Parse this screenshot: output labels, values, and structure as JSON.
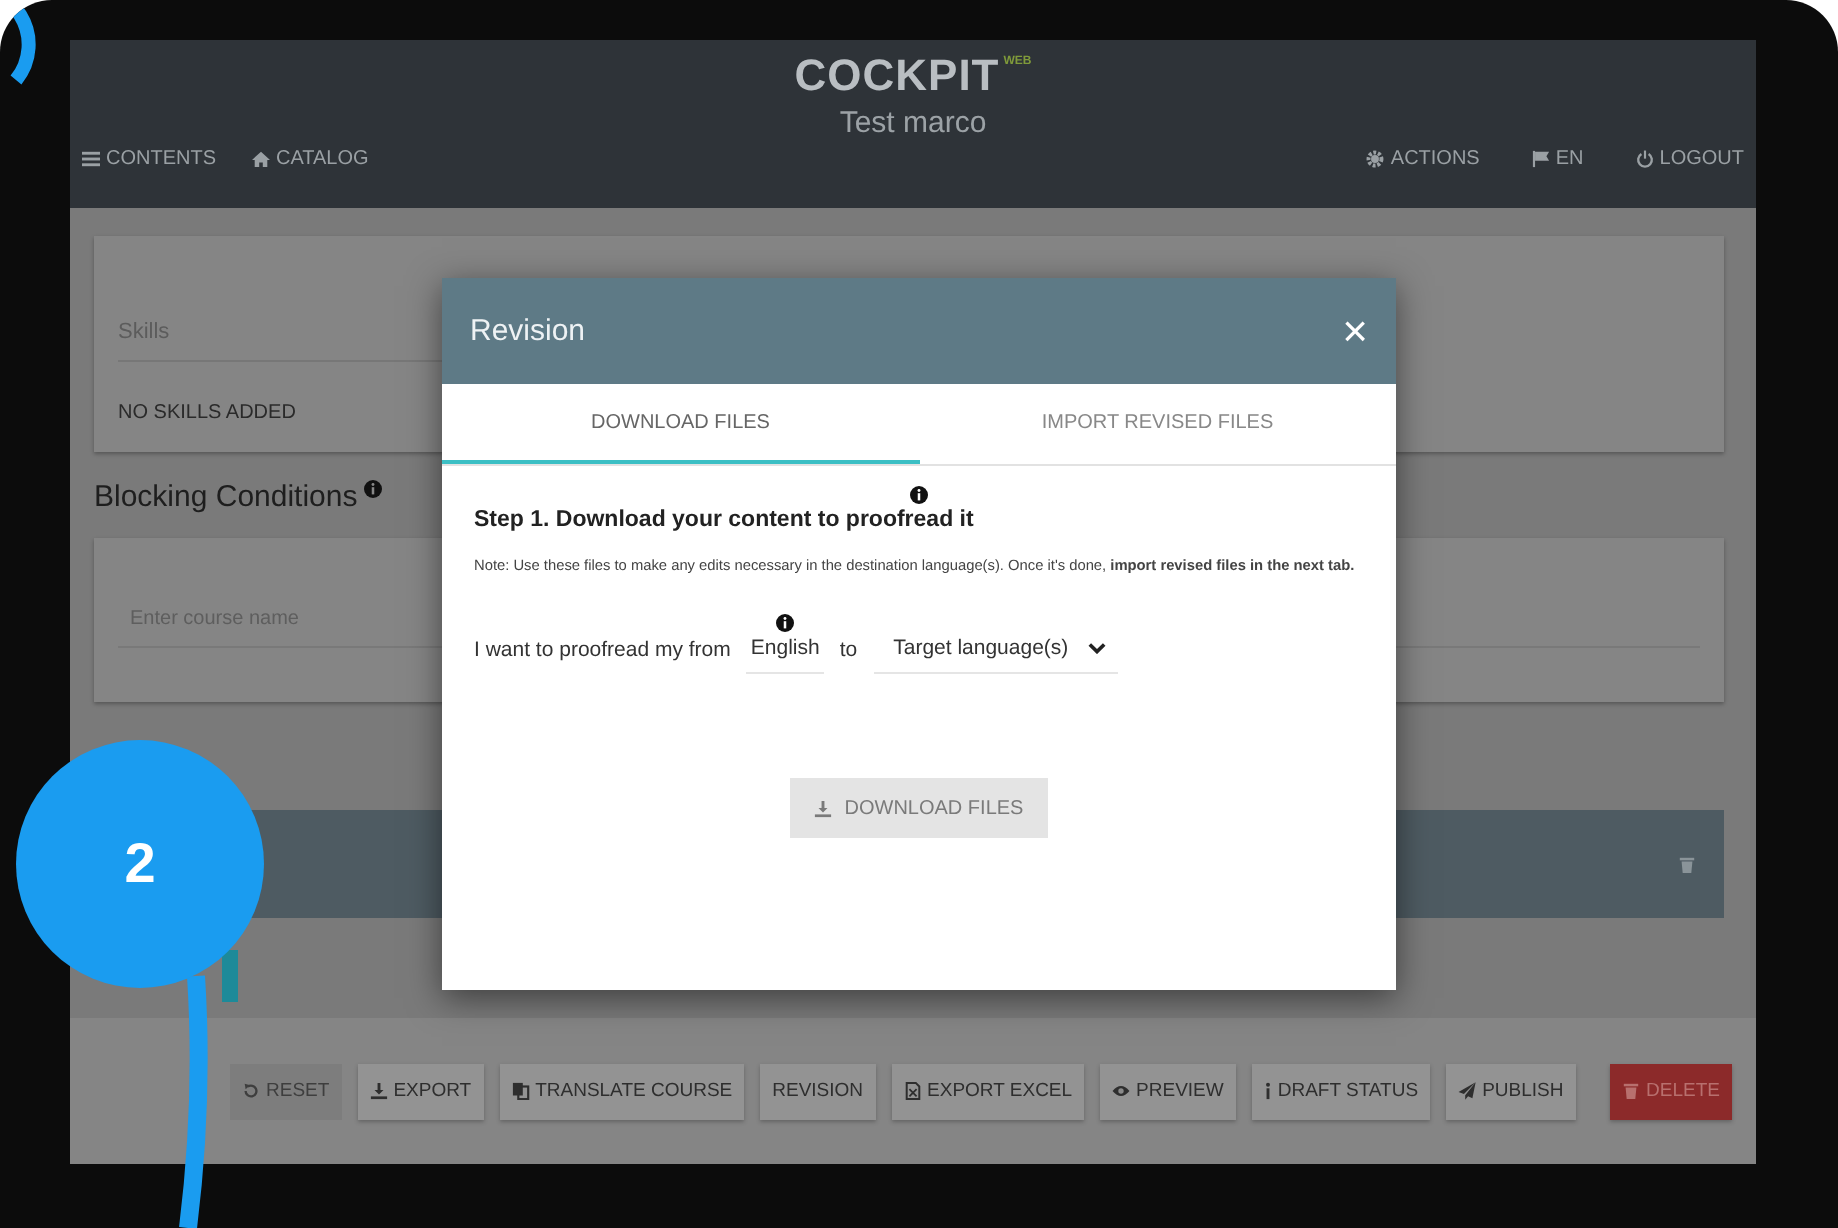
{
  "header": {
    "nav_left": [
      {
        "label": "CONTENTS"
      },
      {
        "label": "CATALOG"
      }
    ],
    "logo": "COCKPIT",
    "logo_badge": "WEB",
    "subtitle": "Test marco",
    "nav_right": [
      {
        "label": "ACTIONS"
      },
      {
        "label": "EN"
      },
      {
        "label": "LOGOUT"
      }
    ]
  },
  "skills": {
    "label": "Skills",
    "empty": "NO SKILLS ADDED"
  },
  "blocking": {
    "title": "Blocking Conditions",
    "placeholder": "Enter course name"
  },
  "toolbar": [
    {
      "label": "RESET",
      "kind": "default",
      "disabled": true
    },
    {
      "label": "EXPORT",
      "kind": "default",
      "disabled": false
    },
    {
      "label": "TRANSLATE COURSE",
      "kind": "default",
      "disabled": false
    },
    {
      "label": "REVISION",
      "kind": "default",
      "disabled": false
    },
    {
      "label": "EXPORT EXCEL",
      "kind": "default",
      "disabled": false
    },
    {
      "label": "PREVIEW",
      "kind": "default",
      "disabled": false
    },
    {
      "label": "DRAFT STATUS",
      "kind": "default",
      "disabled": false
    },
    {
      "label": "PUBLISH",
      "kind": "default",
      "disabled": false
    },
    {
      "label": "DELETE",
      "kind": "danger",
      "disabled": false
    }
  ],
  "modal": {
    "title": "Revision",
    "close": "×",
    "tabs": [
      {
        "label": "DOWNLOAD FILES",
        "selected": true
      },
      {
        "label": "IMPORT REVISED FILES",
        "selected": false
      }
    ],
    "step_title": "Step 1. Download your content to proofread it",
    "note": "Note: Use these files to make any edits necessary in the destination language(s). Once it's done, **import revised files in the next tab.**",
    "sentence_start": "I want to proofread my from",
    "source": "English",
    "to": "to",
    "target_placeholder": "Target language(s)",
    "download": {
      "label": "DOWNLOAD FILES",
      "disabled": true
    }
  },
  "annotation": {
    "number": "2"
  }
}
